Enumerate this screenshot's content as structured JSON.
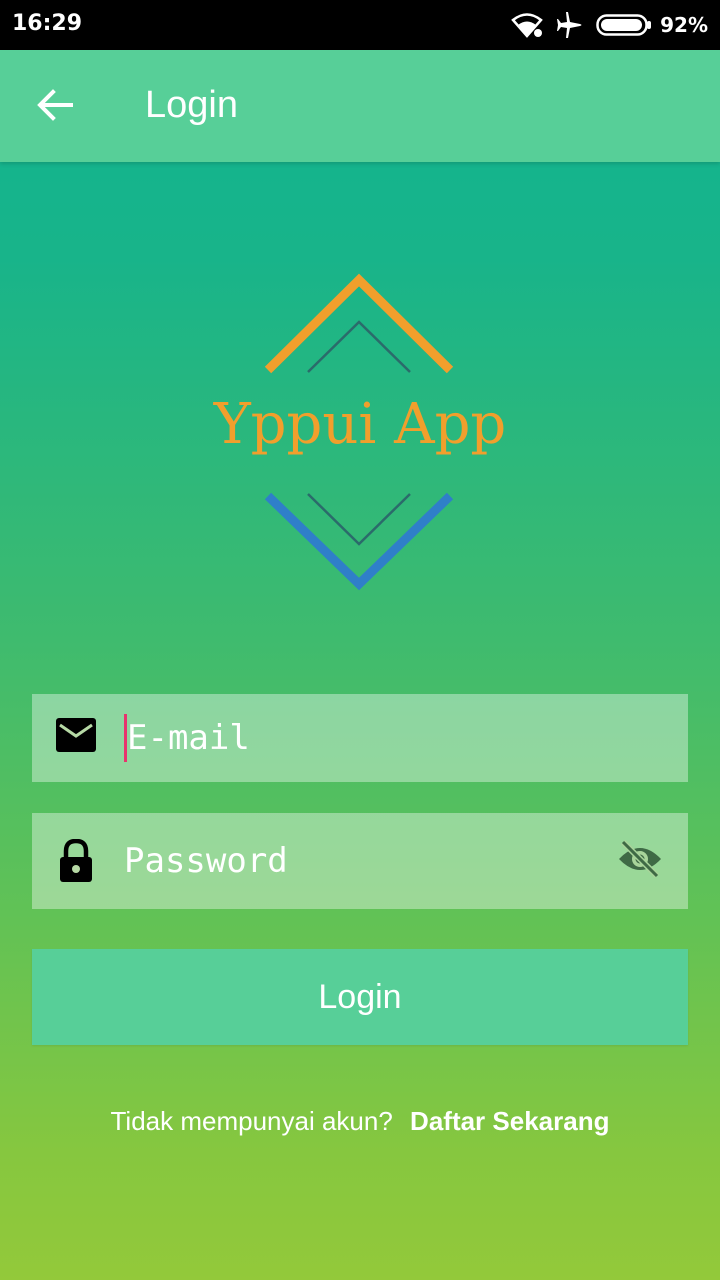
{
  "status_bar": {
    "time": "16:29",
    "battery_percent": "92%",
    "icons": [
      "wifi-icon",
      "airplane-mode-icon",
      "battery-icon"
    ]
  },
  "app_bar": {
    "title": "Login",
    "back_icon": "arrow-left-icon"
  },
  "logo": {
    "text": "Yppui App",
    "colors": {
      "top_chevron": "#f19f2c",
      "bottom_chevron": "#2f7fc9",
      "inner_lines": "#2b6b6b",
      "text": "#f19f2c"
    }
  },
  "form": {
    "email": {
      "placeholder": "E-mail",
      "value": "",
      "icon": "mail-icon"
    },
    "password": {
      "placeholder": "Password",
      "value": "",
      "icon": "lock-icon",
      "toggle_icon": "eye-off-icon"
    },
    "login_button_label": "Login"
  },
  "register": {
    "prompt": "Tidak mempunyai akun?",
    "link_label": "Daftar Sekarang"
  },
  "colors": {
    "app_bar": "#57cf98",
    "button": "#57cf98",
    "cursor": "#e8336d",
    "gradient_top": "#0fb491",
    "gradient_bottom": "#93c93a"
  }
}
